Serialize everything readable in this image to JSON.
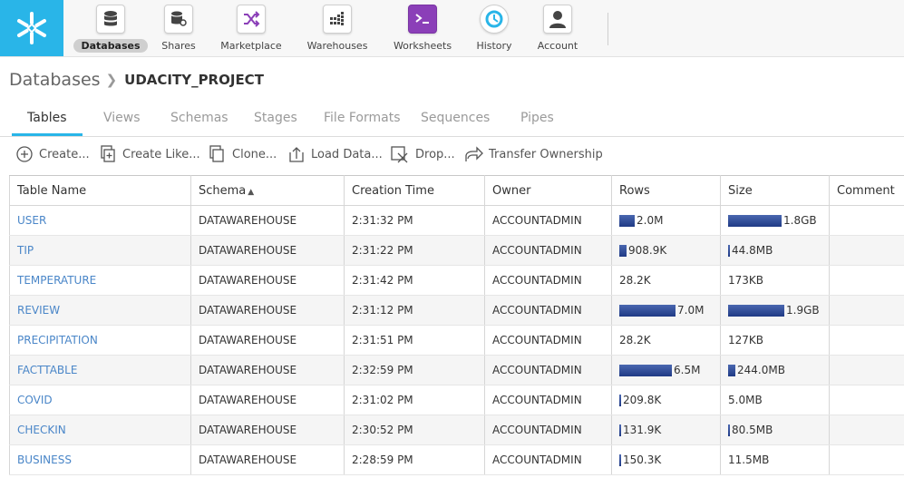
{
  "nav": [
    {
      "label": "Databases",
      "icon": "database-icon",
      "active": true
    },
    {
      "label": "Shares",
      "icon": "share-icon",
      "active": false
    },
    {
      "label": "Marketplace",
      "icon": "shuffle-icon",
      "active": false
    },
    {
      "label": "Warehouses",
      "icon": "warehouse-icon",
      "active": false
    },
    {
      "label": "Worksheets",
      "icon": "terminal-icon",
      "active": false
    },
    {
      "label": "History",
      "icon": "history-icon",
      "active": false
    },
    {
      "label": "Account",
      "icon": "user-icon",
      "active": false
    }
  ],
  "breadcrumb": {
    "root": "Databases",
    "current": "UDACITY_PROJECT"
  },
  "tabs": [
    "Tables",
    "Views",
    "Schemas",
    "Stages",
    "File Formats",
    "Sequences",
    "Pipes"
  ],
  "toolbar": {
    "create": "Create...",
    "create_like": "Create Like...",
    "clone": "Clone...",
    "load_data": "Load Data...",
    "drop": "Drop...",
    "transfer": "Transfer Ownership"
  },
  "columns": [
    "Table Name",
    "Schema",
    "Creation Time",
    "Owner",
    "Rows",
    "Size",
    "Comment"
  ],
  "rows": [
    {
      "name": "USER",
      "schema": "DATAWAREHOUSE",
      "time": "2:31:32 PM",
      "owner": "ACCOUNTADMIN",
      "rows": "2.0M",
      "rows_frac": 0.28,
      "size": "1.8GB",
      "size_frac": 0.95
    },
    {
      "name": "TIP",
      "schema": "DATAWAREHOUSE",
      "time": "2:31:22 PM",
      "owner": "ACCOUNTADMIN",
      "rows": "908.9K",
      "rows_frac": 0.13,
      "size": "44.8MB",
      "size_frac": 0.02
    },
    {
      "name": "TEMPERATURE",
      "schema": "DATAWAREHOUSE",
      "time": "2:31:42 PM",
      "owner": "ACCOUNTADMIN",
      "rows": "28.2K",
      "rows_frac": 0,
      "size": "173KB",
      "size_frac": 0
    },
    {
      "name": "REVIEW",
      "schema": "DATAWAREHOUSE",
      "time": "2:31:12 PM",
      "owner": "ACCOUNTADMIN",
      "rows": "7.0M",
      "rows_frac": 1.0,
      "size": "1.9GB",
      "size_frac": 1.0
    },
    {
      "name": "PRECIPITATION",
      "schema": "DATAWAREHOUSE",
      "time": "2:31:51 PM",
      "owner": "ACCOUNTADMIN",
      "rows": "28.2K",
      "rows_frac": 0,
      "size": "127KB",
      "size_frac": 0
    },
    {
      "name": "FACTTABLE",
      "schema": "DATAWAREHOUSE",
      "time": "2:32:59 PM",
      "owner": "ACCOUNTADMIN",
      "rows": "6.5M",
      "rows_frac": 0.93,
      "size": "244.0MB",
      "size_frac": 0.13
    },
    {
      "name": "COVID",
      "schema": "DATAWAREHOUSE",
      "time": "2:31:02 PM",
      "owner": "ACCOUNTADMIN",
      "rows": "209.8K",
      "rows_frac": 0.03,
      "size": "5.0MB",
      "size_frac": 0
    },
    {
      "name": "CHECKIN",
      "schema": "DATAWAREHOUSE",
      "time": "2:30:52 PM",
      "owner": "ACCOUNTADMIN",
      "rows": "131.9K",
      "rows_frac": 0.02,
      "size": "80.5MB",
      "size_frac": 0.04
    },
    {
      "name": "BUSINESS",
      "schema": "DATAWAREHOUSE",
      "time": "2:28:59 PM",
      "owner": "ACCOUNTADMIN",
      "rows": "150.3K",
      "rows_frac": 0.02,
      "size": "11.5MB",
      "size_frac": 0
    }
  ]
}
